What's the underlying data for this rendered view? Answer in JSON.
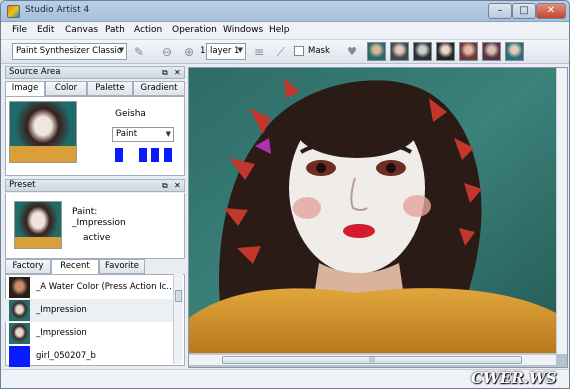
{
  "window": {
    "title": "Studio Artist 4"
  },
  "menu": [
    "File",
    "Edit",
    "Canvas",
    "Path",
    "Action",
    "Operation",
    "Windows",
    "Help"
  ],
  "toolbar": {
    "synth_select": "Paint Synthesizer Classic",
    "zoom_value": "1",
    "layer_select": "layer 1",
    "mask_label": "Mask"
  },
  "source_area": {
    "title": "Source Area",
    "tabs": [
      "Image",
      "Color",
      "Palette",
      "Gradient"
    ],
    "source_name": "Geisha",
    "mode_select": "Paint"
  },
  "preset": {
    "title": "Preset",
    "type_label": "Paint:",
    "name": "_Impression",
    "status": "active",
    "tabs": [
      "Factory",
      "Recent",
      "Favorite"
    ],
    "items": [
      "_A Water Color (Press Action Ic...",
      "_Impression",
      "_Impression",
      "girl_050207_b"
    ]
  },
  "watermark": "CWER.WS",
  "colors": {
    "accent_blue": "#0a1cff",
    "title_bar": "#bcd0e6",
    "close_button": "#c4432c",
    "canvas_teal": "#2e6f6a",
    "sweater_orange": "#d89a2a"
  }
}
